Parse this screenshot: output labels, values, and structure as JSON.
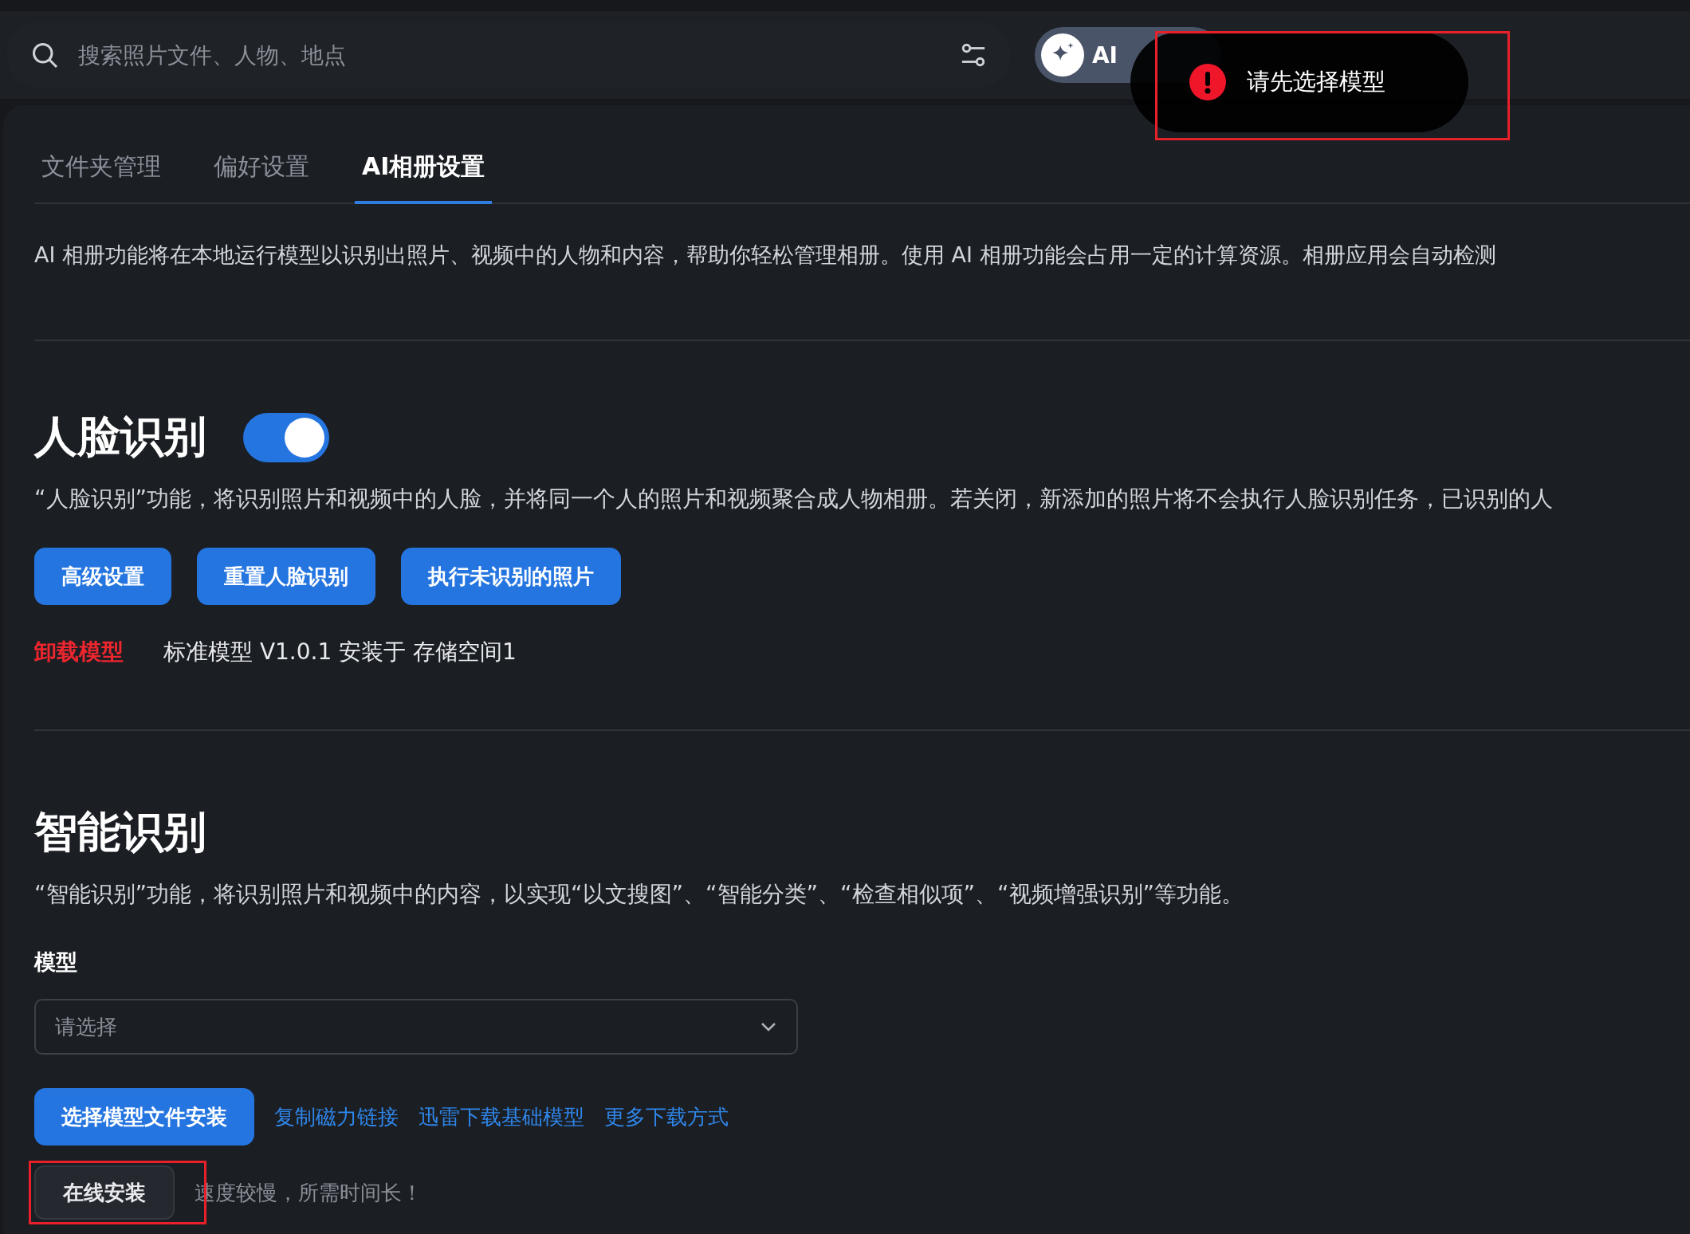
{
  "search": {
    "placeholder": "搜索照片文件、人物、地点"
  },
  "ai_status": {
    "label": "AI"
  },
  "toast": {
    "kind": "error",
    "message": "请先选择模型"
  },
  "tabs": [
    {
      "label": "文件夹管理",
      "selected": false
    },
    {
      "label": "偏好设置",
      "selected": false
    },
    {
      "label": "AI相册设置",
      "selected": true
    }
  ],
  "intro": "AI 相册功能将在本地运行模型以识别出照片、视频中的人物和内容，帮助你轻松管理相册。使用 AI 相册功能会占用一定的计算资源。相册应用会自动检测",
  "face_recognition": {
    "title": "人脸识别",
    "on": true,
    "description": "“人脸识别”功能，将识别照片和视频中的人脸，并将同一个人的照片和视频聚合成人物相册。若关闭，新添加的照片将不会执行人脸识别任务，已识别的人",
    "buttons": [
      "高级设置",
      "重置人脸识别",
      "执行未识别的照片"
    ],
    "uninstall_link": "卸载模型",
    "model_info": "标准模型 V1.0.1 安装于 存储空间1"
  },
  "smart_recognition": {
    "title": "智能识别",
    "description": "“智能识别”功能，将识别照片和视频中的内容，以实现“以文搜图”、“智能分类”、“检查相似项”、“视频增强识别”等功能。",
    "model_label": "模型",
    "model_select": {
      "placeholder": "请选择"
    },
    "install_button": "选择模型文件安装",
    "links": [
      "复制磁力链接",
      "迅雷下载基础模型",
      "更多下载方式"
    ],
    "online_install_button": "在线安装",
    "online_install_note": "速度较慢，所需时间长！"
  }
}
